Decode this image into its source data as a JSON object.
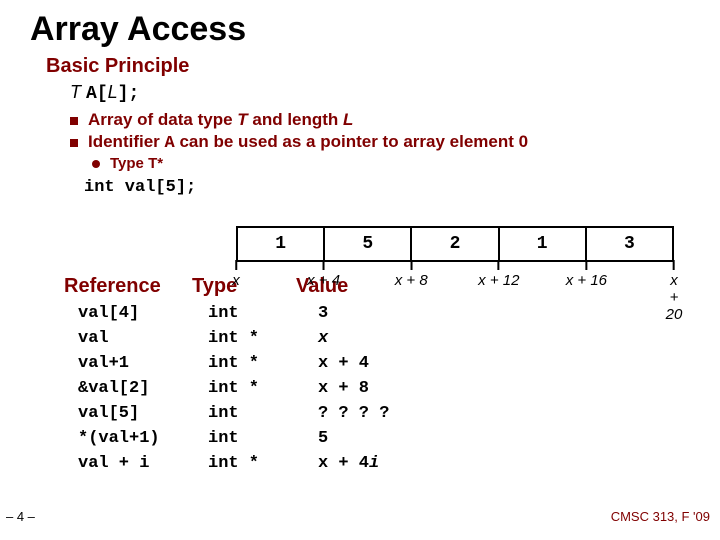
{
  "title": "Array Access",
  "subhead": "Basic Principle",
  "decl": {
    "T": "T",
    "code": "A[",
    "L": "L",
    "end": "];"
  },
  "bullets": {
    "b1_pre": "Array of data type ",
    "b1_T": "T",
    "b1_mid": " and length ",
    "b1_L": "L",
    "b2_pre": "Identifier ",
    "b2_A": "A",
    "b2_post": " can be used as a pointer to array element 0",
    "c1_pre": "Type ",
    "c1_T": "T",
    "c1_post": "*"
  },
  "code_decl": "int val[5];",
  "cells": [
    "1",
    "5",
    "2",
    "1",
    "3"
  ],
  "ticks": [
    "x",
    "x + 4",
    "x + 8",
    "x + 12",
    "x + 16",
    "x + 20"
  ],
  "headers": {
    "ref": "Reference",
    "type": "Type",
    "value": "Value"
  },
  "rows": [
    {
      "ref": "val[4]",
      "type": "int",
      "val": "3"
    },
    {
      "ref": "val",
      "type": "int *",
      "val": "x"
    },
    {
      "ref": "val+1",
      "type": "int *",
      "val": "x + 4"
    },
    {
      "ref": "&val[2]",
      "type": "int *",
      "val": "x + 8"
    },
    {
      "ref": "val[5]",
      "type": "int",
      "val": "? ? ? ?"
    },
    {
      "ref": "*(val+1)",
      "type": "int",
      "val": "5"
    },
    {
      "ref": "val + i",
      "type": "int *",
      "val": "x + 4i",
      "ital_i": true
    }
  ],
  "footer": {
    "left": "– 4 –",
    "right": "CMSC 313, F '09"
  }
}
